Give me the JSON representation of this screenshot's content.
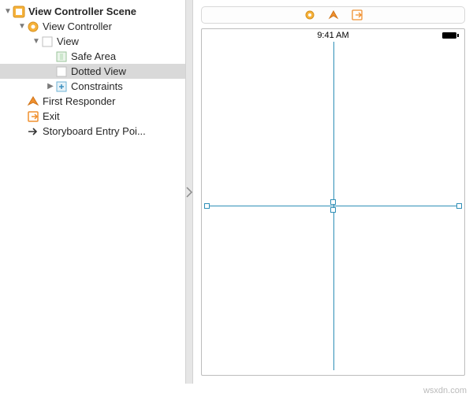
{
  "outline": {
    "scene": {
      "label": "View Controller Scene"
    },
    "vc": {
      "label": "View Controller"
    },
    "view": {
      "label": "View"
    },
    "safeArea": {
      "label": "Safe Area"
    },
    "dottedView": {
      "label": "Dotted View"
    },
    "constraints": {
      "label": "Constraints"
    },
    "firstResponder": {
      "label": "First Responder"
    },
    "exit": {
      "label": "Exit"
    },
    "entry": {
      "label": "Storyboard Entry Poi..."
    }
  },
  "statusbar": {
    "time": "9:41 AM"
  },
  "watermark": "wsxdn.com",
  "colors": {
    "orange": "#f0902f",
    "guide": "#2f8fb7",
    "selection": "#d9d9d9"
  }
}
